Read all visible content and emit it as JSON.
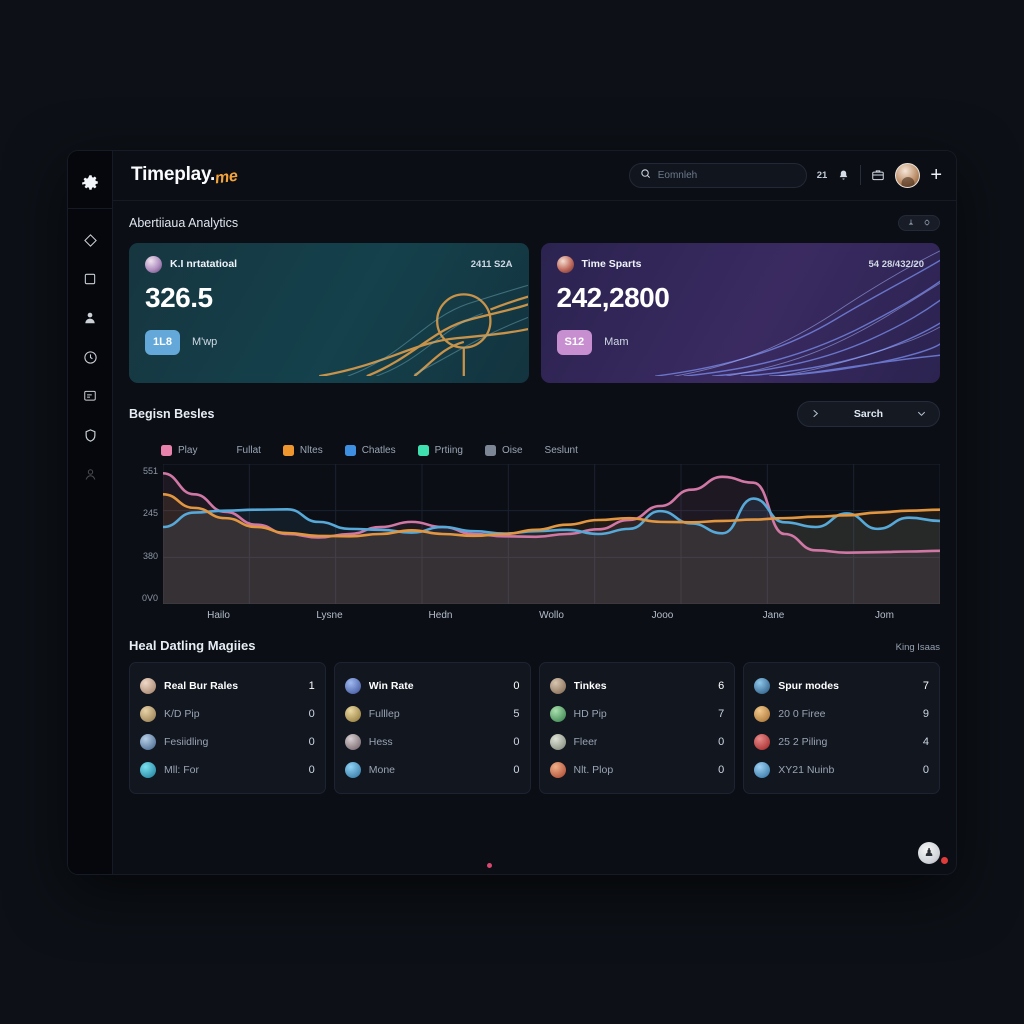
{
  "brand": {
    "name": "Timeplay",
    "dot": ".",
    "suffix": "me"
  },
  "topbar": {
    "search_placeholder": "Eomnleh",
    "notif_count": "21",
    "icons": [
      "search-icon",
      "bell-icon",
      "briefcase-icon",
      "avatar",
      "plus-icon"
    ],
    "plus_label": "+"
  },
  "sidebar": {
    "items": [
      {
        "name": "diamond",
        "label": "Diamond"
      },
      {
        "name": "square",
        "label": "Square"
      },
      {
        "name": "person",
        "label": "Person"
      },
      {
        "name": "clock",
        "label": "Clock"
      },
      {
        "name": "message",
        "label": "Message"
      },
      {
        "name": "shield",
        "label": "Shield"
      },
      {
        "name": "user-dim",
        "label": "User"
      }
    ]
  },
  "page": {
    "title": "Abertiiaua Analytics"
  },
  "stat_cards": [
    {
      "label": "K.I nrtatatioal",
      "meta": "2411 S2A",
      "value": "326.5",
      "chip": "1L8",
      "chip_text": "M'wp",
      "accent": "#63a8d8",
      "theme": "teal"
    },
    {
      "label": "Time Sparts",
      "meta": "54 28/432/20",
      "value": "242,2800",
      "chip": "S12",
      "chip_text": "Mam",
      "accent": "#c88fd0",
      "theme": "purple"
    }
  ],
  "chart_section": {
    "title": "Begisn Besles",
    "dropdown_label": "Sarch",
    "trailing_label": "Seslunt"
  },
  "chart_data": {
    "type": "line",
    "title": "Begisn Besles",
    "xlabel": "",
    "ylabel": "",
    "grid": true,
    "legend_position": "top",
    "categories": [
      "Hailo",
      "Lysne",
      "Hedn",
      "Wollo",
      "Jooo",
      "Jane",
      "Jom"
    ],
    "yticks": [
      "551",
      "245",
      "380",
      "0V0"
    ],
    "ylim": [
      0,
      600
    ],
    "legend": [
      {
        "label": "Play",
        "color": "#e882ad"
      },
      {
        "label": "Fullat",
        "color": ""
      },
      {
        "label": "Nltes",
        "color": "#f0962f"
      },
      {
        "label": "Chatles",
        "color": "#3f8fe0"
      },
      {
        "label": "Prtiing",
        "color": "#3ee0b0"
      },
      {
        "label": "Oise",
        "color": "#7d8695"
      }
    ],
    "series": [
      {
        "name": "Play",
        "color": "#d177a5",
        "values": [
          560,
          470,
          395,
          340,
          300,
          285,
          300,
          330,
          352,
          330,
          300,
          290,
          288,
          300,
          320,
          360,
          420,
          490,
          545,
          520,
          300,
          230,
          220,
          222,
          225,
          228
        ]
      },
      {
        "name": "Chatles",
        "color": "#56a9d8",
        "values": [
          330,
          392,
          400,
          404,
          406,
          352,
          322,
          318,
          306,
          330,
          312,
          302,
          312,
          318,
          300,
          322,
          398,
          345,
          303,
          452,
          350,
          330,
          388,
          322,
          370,
          356
        ]
      },
      {
        "name": "Nltes",
        "color": "#e2963f",
        "values": [
          470,
          412,
          368,
          330,
          304,
          292,
          290,
          300,
          316,
          300,
          292,
          300,
          318,
          340,
          360,
          368,
          352,
          350,
          356,
          362,
          368,
          374,
          380,
          392,
          400,
          404
        ]
      }
    ]
  },
  "bottom": {
    "title": "Heal Datling Magiies",
    "subtitle": "King Isaas",
    "panels": [
      {
        "rows": [
          {
            "name": "Real Bur Rales",
            "value": "1",
            "color1": "#f0d9c8",
            "color2": "#9b7a62"
          },
          {
            "name": "K/D Pip",
            "value": "0",
            "color1": "#e8d3a8",
            "color2": "#8c7548"
          },
          {
            "name": "Fesiidling",
            "value": "0",
            "color1": "#b7cfe8",
            "color2": "#3d5f85"
          },
          {
            "name": "Mll: For",
            "value": "0",
            "color1": "#7ae0f0",
            "color2": "#1a7a96"
          }
        ]
      },
      {
        "rows": [
          {
            "name": "Win Rate",
            "value": "0",
            "color1": "#9fb9f0",
            "color2": "#3a4e96"
          },
          {
            "name": "Fulllep",
            "value": "5",
            "color1": "#ead9a2",
            "color2": "#8a7030"
          },
          {
            "name": "Hess",
            "value": "0",
            "color1": "#d8cfd2",
            "color2": "#6a5a60"
          },
          {
            "name": "Mone",
            "value": "0",
            "color1": "#8fd2f5",
            "color2": "#2b6f9c"
          }
        ]
      },
      {
        "rows": [
          {
            "name": "Tinkes",
            "value": "6",
            "color1": "#d8c6b0",
            "color2": "#7a604a"
          },
          {
            "name": "HD Pip",
            "value": "7",
            "color1": "#a9e0ae",
            "color2": "#2f7a45"
          },
          {
            "name": "Fleer",
            "value": "0",
            "color1": "#dfe3d8",
            "color2": "#788070"
          },
          {
            "name": "Nlt. Plop",
            "value": "0",
            "color1": "#f0b089",
            "color2": "#a6402a"
          }
        ]
      },
      {
        "rows": [
          {
            "name": "Spur modes",
            "value": "7",
            "color1": "#8fc6ea",
            "color2": "#24527a"
          },
          {
            "name": "20 0 Firee",
            "value": "9",
            "color1": "#f2c88c",
            "color2": "#a06b2c"
          },
          {
            "name": "25 2 Piling",
            "value": "4",
            "color1": "#e88a8a",
            "color2": "#9c2020"
          },
          {
            "name": "XY21 Nuinb",
            "value": "0",
            "color1": "#9ed0f2",
            "color2": "#2a6e9e"
          }
        ]
      }
    ]
  },
  "fab": {
    "icon": "avatar-fab",
    "glyph": "♟"
  }
}
